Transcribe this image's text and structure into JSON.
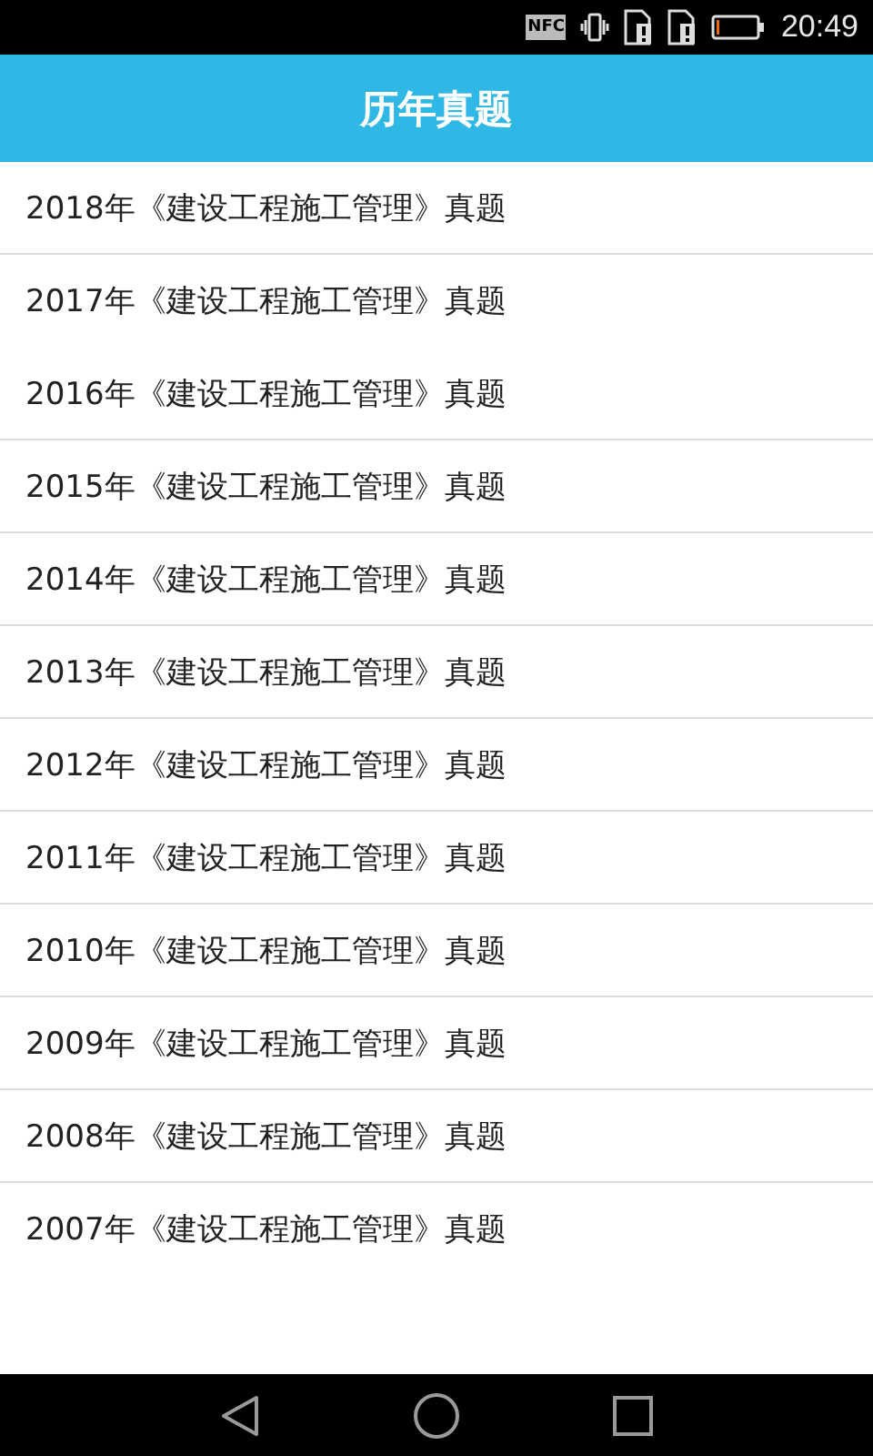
{
  "status_bar": {
    "nfc": "NFC",
    "time": "20:49"
  },
  "header": {
    "title": "历年真题"
  },
  "items": [
    {
      "label": "2018年《建设工程施工管理》真题",
      "divider": true
    },
    {
      "label": "2017年《建设工程施工管理》真题",
      "divider": false
    },
    {
      "label": "2016年《建设工程施工管理》真题",
      "divider": true
    },
    {
      "label": "2015年《建设工程施工管理》真题",
      "divider": true
    },
    {
      "label": "2014年《建设工程施工管理》真题",
      "divider": true
    },
    {
      "label": "2013年《建设工程施工管理》真题",
      "divider": true
    },
    {
      "label": "2012年《建设工程施工管理》真题",
      "divider": true
    },
    {
      "label": "2011年《建设工程施工管理》真题",
      "divider": true
    },
    {
      "label": "2010年《建设工程施工管理》真题",
      "divider": true
    },
    {
      "label": "2009年《建设工程施工管理》真题",
      "divider": true
    },
    {
      "label": "2008年《建设工程施工管理》真题",
      "divider": true
    },
    {
      "label": "2007年《建设工程施工管理》真题",
      "divider": false
    }
  ]
}
